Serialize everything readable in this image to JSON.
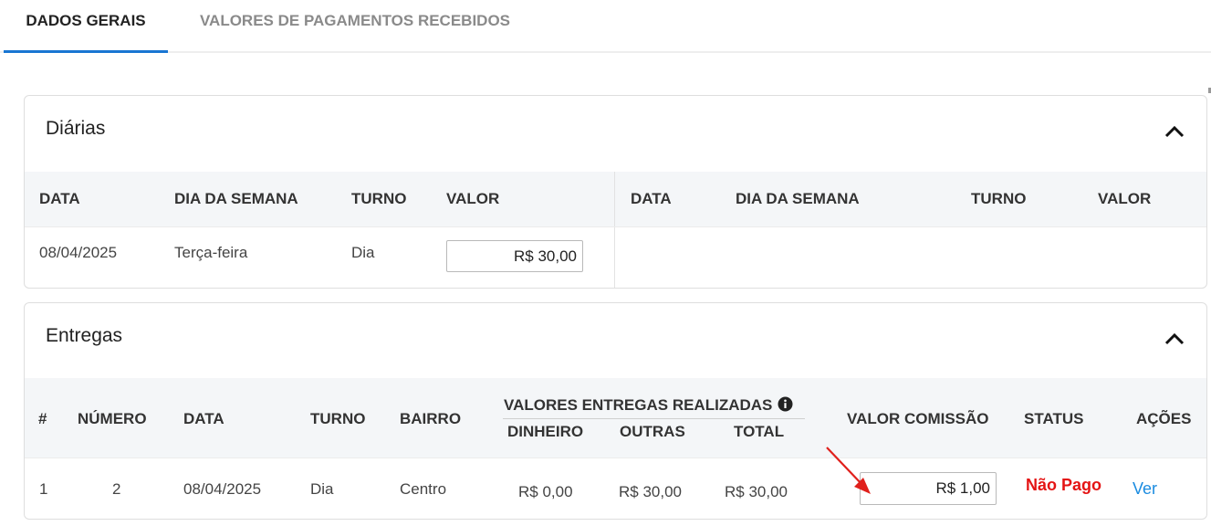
{
  "tabs": [
    {
      "label": "DADOS GERAIS",
      "active": true
    },
    {
      "label": "VALORES DE PAGAMENTOS RECEBIDOS",
      "active": false
    }
  ],
  "diarias": {
    "title": "Diárias",
    "collapse_icon": "chevron-up-icon",
    "columns_left": [
      "DATA",
      "DIA DA SEMANA",
      "TURNO",
      "VALOR"
    ],
    "columns_right": [
      "DATA",
      "DIA DA SEMANA",
      "TURNO",
      "VALOR"
    ],
    "rows": [
      {
        "data": "08/04/2025",
        "dia_semana": "Terça-feira",
        "turno": "Dia",
        "valor": "R$ 30,00"
      }
    ]
  },
  "entregas": {
    "title": "Entregas",
    "collapse_icon": "chevron-up-icon",
    "columns": {
      "num": "#",
      "numero": "NÚMERO",
      "data": "DATA",
      "turno": "TURNO",
      "bairro": "BAIRRO",
      "valores_group": "VALORES ENTREGAS REALIZADAS",
      "dinheiro": "DINHEIRO",
      "outras": "OUTRAS",
      "total": "TOTAL",
      "valor_comissao": "VALOR COMISSÃO",
      "status": "STATUS",
      "acoes": "AÇÕES"
    },
    "info_icon": "info-icon",
    "rows": [
      {
        "num": "1",
        "numero": "2",
        "data": "08/04/2025",
        "turno": "Dia",
        "bairro": "Centro",
        "dinheiro": "R$ 0,00",
        "outras": "R$ 30,00",
        "total": "R$ 30,00",
        "valor_comissao": "R$ 1,00",
        "status": "Não Pago",
        "acao": "Ver"
      }
    ]
  },
  "colors": {
    "accent": "#1976d2",
    "status_unpaid": "#e41414",
    "link": "#1a8be0",
    "annotation_arrow": "#e0201c"
  }
}
